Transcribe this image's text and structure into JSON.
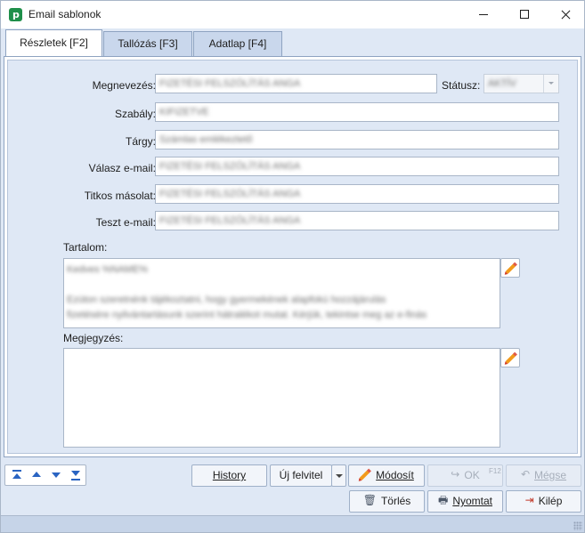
{
  "window": {
    "title": "Email sablonok",
    "brand_color": "#1f8f4a",
    "app_icon_letter": "p"
  },
  "tabs": [
    {
      "label": "Részletek [F2]",
      "active": true
    },
    {
      "label": "Tallózás [F3]",
      "active": false
    },
    {
      "label": "Adatlap [F4]",
      "active": false
    }
  ],
  "form": {
    "megnevezes": {
      "label": "Megnevezés:",
      "value": "FIZETÉSI FELSZÓLÍTÁS ANGA"
    },
    "statusz": {
      "label": "Státusz:",
      "value": "AKTÍV"
    },
    "szabaly": {
      "label": "Szabály:",
      "value": "KIFIZETVE"
    },
    "targy": {
      "label": "Tárgy:",
      "value": "Számlas emlékeztető"
    },
    "valasz_email": {
      "label": "Válasz e-mail:",
      "value": "FIZETÉSI FELSZÓLÍTÁS ANGA"
    },
    "titkos_masolat": {
      "label": "Titkos másolat:",
      "value": "FIZETÉSI FELSZÓLÍTÁS ANGA"
    },
    "teszt_email": {
      "label": "Teszt e-mail:",
      "value": "FIZETÉSI FELSZÓLÍTÁS ANGA"
    },
    "tartalom": {
      "label": "Tartalom:",
      "lines": [
        "Kedves %NAME%",
        "",
        "Ezúton szeretnénk tájékoztatni, hogy gyermekének alapfokú hozzájárulás",
        "fizetésére nyilvántartásunk szerint hátralékot mutat. Kérjük, tekintse meg az e-finás"
      ]
    },
    "megjegyzes": {
      "label": "Megjegyzés:",
      "value": ""
    }
  },
  "toolbar": {
    "history": "History",
    "uj_felvitel": "Új felvitel",
    "modosit": "Módosít",
    "ok": "OK",
    "ok_shortcut": "F12",
    "megse": "Mégse",
    "torles": "Törlés",
    "nyomtat": "Nyomtat",
    "kilep": "Kilép"
  },
  "colors": {
    "panel_bg": "#dfe8f5",
    "tab_inactive": "#c9d7ec",
    "nav_arrow": "#2a64c2",
    "pencil": "#f29a1b"
  }
}
